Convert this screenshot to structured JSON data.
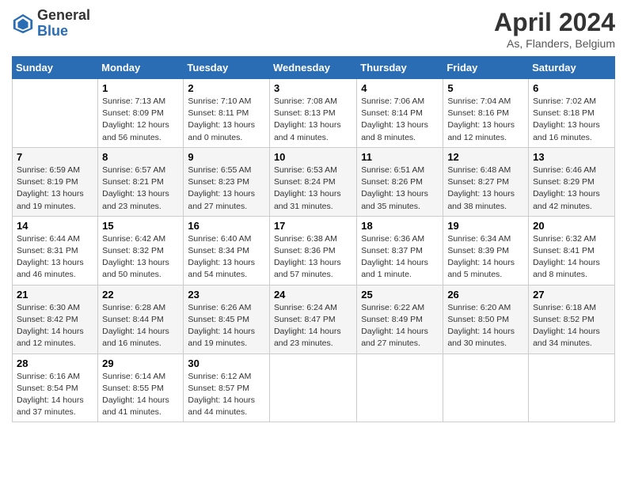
{
  "header": {
    "logo_line1": "General",
    "logo_line2": "Blue",
    "main_title": "April 2024",
    "subtitle": "As, Flanders, Belgium"
  },
  "days_of_week": [
    "Sunday",
    "Monday",
    "Tuesday",
    "Wednesday",
    "Thursday",
    "Friday",
    "Saturday"
  ],
  "weeks": [
    [
      {
        "day": "",
        "info": ""
      },
      {
        "day": "1",
        "info": "Sunrise: 7:13 AM\nSunset: 8:09 PM\nDaylight: 12 hours\nand 56 minutes."
      },
      {
        "day": "2",
        "info": "Sunrise: 7:10 AM\nSunset: 8:11 PM\nDaylight: 13 hours\nand 0 minutes."
      },
      {
        "day": "3",
        "info": "Sunrise: 7:08 AM\nSunset: 8:13 PM\nDaylight: 13 hours\nand 4 minutes."
      },
      {
        "day": "4",
        "info": "Sunrise: 7:06 AM\nSunset: 8:14 PM\nDaylight: 13 hours\nand 8 minutes."
      },
      {
        "day": "5",
        "info": "Sunrise: 7:04 AM\nSunset: 8:16 PM\nDaylight: 13 hours\nand 12 minutes."
      },
      {
        "day": "6",
        "info": "Sunrise: 7:02 AM\nSunset: 8:18 PM\nDaylight: 13 hours\nand 16 minutes."
      }
    ],
    [
      {
        "day": "7",
        "info": "Sunrise: 6:59 AM\nSunset: 8:19 PM\nDaylight: 13 hours\nand 19 minutes."
      },
      {
        "day": "8",
        "info": "Sunrise: 6:57 AM\nSunset: 8:21 PM\nDaylight: 13 hours\nand 23 minutes."
      },
      {
        "day": "9",
        "info": "Sunrise: 6:55 AM\nSunset: 8:23 PM\nDaylight: 13 hours\nand 27 minutes."
      },
      {
        "day": "10",
        "info": "Sunrise: 6:53 AM\nSunset: 8:24 PM\nDaylight: 13 hours\nand 31 minutes."
      },
      {
        "day": "11",
        "info": "Sunrise: 6:51 AM\nSunset: 8:26 PM\nDaylight: 13 hours\nand 35 minutes."
      },
      {
        "day": "12",
        "info": "Sunrise: 6:48 AM\nSunset: 8:27 PM\nDaylight: 13 hours\nand 38 minutes."
      },
      {
        "day": "13",
        "info": "Sunrise: 6:46 AM\nSunset: 8:29 PM\nDaylight: 13 hours\nand 42 minutes."
      }
    ],
    [
      {
        "day": "14",
        "info": "Sunrise: 6:44 AM\nSunset: 8:31 PM\nDaylight: 13 hours\nand 46 minutes."
      },
      {
        "day": "15",
        "info": "Sunrise: 6:42 AM\nSunset: 8:32 PM\nDaylight: 13 hours\nand 50 minutes."
      },
      {
        "day": "16",
        "info": "Sunrise: 6:40 AM\nSunset: 8:34 PM\nDaylight: 13 hours\nand 54 minutes."
      },
      {
        "day": "17",
        "info": "Sunrise: 6:38 AM\nSunset: 8:36 PM\nDaylight: 13 hours\nand 57 minutes."
      },
      {
        "day": "18",
        "info": "Sunrise: 6:36 AM\nSunset: 8:37 PM\nDaylight: 14 hours\nand 1 minute."
      },
      {
        "day": "19",
        "info": "Sunrise: 6:34 AM\nSunset: 8:39 PM\nDaylight: 14 hours\nand 5 minutes."
      },
      {
        "day": "20",
        "info": "Sunrise: 6:32 AM\nSunset: 8:41 PM\nDaylight: 14 hours\nand 8 minutes."
      }
    ],
    [
      {
        "day": "21",
        "info": "Sunrise: 6:30 AM\nSunset: 8:42 PM\nDaylight: 14 hours\nand 12 minutes."
      },
      {
        "day": "22",
        "info": "Sunrise: 6:28 AM\nSunset: 8:44 PM\nDaylight: 14 hours\nand 16 minutes."
      },
      {
        "day": "23",
        "info": "Sunrise: 6:26 AM\nSunset: 8:45 PM\nDaylight: 14 hours\nand 19 minutes."
      },
      {
        "day": "24",
        "info": "Sunrise: 6:24 AM\nSunset: 8:47 PM\nDaylight: 14 hours\nand 23 minutes."
      },
      {
        "day": "25",
        "info": "Sunrise: 6:22 AM\nSunset: 8:49 PM\nDaylight: 14 hours\nand 27 minutes."
      },
      {
        "day": "26",
        "info": "Sunrise: 6:20 AM\nSunset: 8:50 PM\nDaylight: 14 hours\nand 30 minutes."
      },
      {
        "day": "27",
        "info": "Sunrise: 6:18 AM\nSunset: 8:52 PM\nDaylight: 14 hours\nand 34 minutes."
      }
    ],
    [
      {
        "day": "28",
        "info": "Sunrise: 6:16 AM\nSunset: 8:54 PM\nDaylight: 14 hours\nand 37 minutes."
      },
      {
        "day": "29",
        "info": "Sunrise: 6:14 AM\nSunset: 8:55 PM\nDaylight: 14 hours\nand 41 minutes."
      },
      {
        "day": "30",
        "info": "Sunrise: 6:12 AM\nSunset: 8:57 PM\nDaylight: 14 hours\nand 44 minutes."
      },
      {
        "day": "",
        "info": ""
      },
      {
        "day": "",
        "info": ""
      },
      {
        "day": "",
        "info": ""
      },
      {
        "day": "",
        "info": ""
      }
    ]
  ]
}
